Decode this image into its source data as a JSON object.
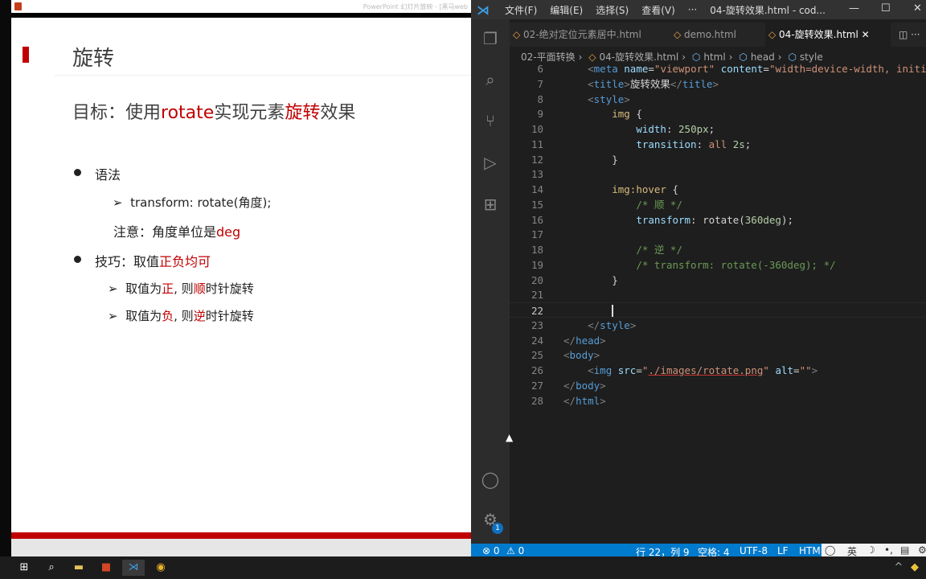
{
  "ppt": {
    "window_title": "PowerPoint 幻灯片放映 - [黑马web",
    "slide": {
      "title": "旋转",
      "goal": {
        "prefix": "目标：使用",
        "rotate": "rotate",
        "mid": "实现元素",
        "em": "旋转",
        "suffix": "效果"
      },
      "syntax_label": "语法",
      "syntax_item": "transform: rotate(角度);",
      "note": {
        "prefix": "注意：角度单位是",
        "em": "deg"
      },
      "tip": {
        "prefix": "技巧：取值",
        "em": "正负均可"
      },
      "tip_items": [
        {
          "a": "取值为",
          "b": "正",
          "c": ", 则",
          "d": "顺",
          "e": "时针旋转"
        },
        {
          "a": "取值为",
          "b": "负",
          "c": ", 则",
          "d": "逆",
          "e": "时针旋转"
        }
      ]
    }
  },
  "vscode": {
    "menu": [
      "文件(F)",
      "编辑(E)",
      "选择(S)",
      "查看(V)",
      "···"
    ],
    "window_title": "04-旋转效果.html - cod...",
    "tabs": [
      {
        "label": "02-绝对定位元素居中.html",
        "active": false
      },
      {
        "label": "demo.html",
        "active": false
      },
      {
        "label": "04-旋转效果.html",
        "active": true
      }
    ],
    "breadcrumb": [
      "02-平面转换",
      "04-旋转效果.html",
      "html",
      "head",
      "style"
    ],
    "current_line": 22,
    "lines": [
      {
        "n": 6,
        "t": [
          [
            "    ",
            "tx"
          ],
          [
            "<",
            "p"
          ],
          [
            "meta",
            "tg"
          ],
          [
            " name",
            "at"
          ],
          [
            "=",
            "tx"
          ],
          [
            "\"viewport\"",
            "st"
          ],
          [
            " content",
            "at"
          ],
          [
            "=",
            "tx"
          ],
          [
            "\"width=device-width, initi",
            "st"
          ]
        ]
      },
      {
        "n": 7,
        "t": [
          [
            "    ",
            "tx"
          ],
          [
            "<",
            "p"
          ],
          [
            "title",
            "tg"
          ],
          [
            ">",
            "p"
          ],
          [
            "旋转效果",
            "tx"
          ],
          [
            "</",
            "p"
          ],
          [
            "title",
            "tg"
          ],
          [
            ">",
            "p"
          ]
        ]
      },
      {
        "n": 8,
        "t": [
          [
            "    ",
            "tx"
          ],
          [
            "<",
            "p"
          ],
          [
            "style",
            "tg"
          ],
          [
            ">",
            "p"
          ]
        ]
      },
      {
        "n": 9,
        "t": [
          [
            "        ",
            "tx"
          ],
          [
            "img",
            "sel"
          ],
          [
            " {",
            "tx"
          ]
        ]
      },
      {
        "n": 10,
        "t": [
          [
            "            ",
            "tx"
          ],
          [
            "width",
            "pr"
          ],
          [
            ": ",
            "tx"
          ],
          [
            "250px",
            "n"
          ],
          [
            ";",
            "tx"
          ]
        ]
      },
      {
        "n": 11,
        "t": [
          [
            "            ",
            "tx"
          ],
          [
            "transition",
            "pr"
          ],
          [
            ": ",
            "tx"
          ],
          [
            "all",
            "v"
          ],
          [
            " 2s",
            "n"
          ],
          [
            ";",
            "tx"
          ]
        ]
      },
      {
        "n": 12,
        "t": [
          [
            "        ",
            "tx"
          ],
          [
            "}",
            "tx"
          ]
        ]
      },
      {
        "n": 13,
        "t": []
      },
      {
        "n": 14,
        "t": [
          [
            "        ",
            "tx"
          ],
          [
            "img:hover",
            "sel"
          ],
          [
            " {",
            "tx"
          ]
        ]
      },
      {
        "n": 15,
        "t": [
          [
            "            ",
            "tx"
          ],
          [
            "/* 顺 */",
            "cm"
          ]
        ]
      },
      {
        "n": 16,
        "t": [
          [
            "            ",
            "tx"
          ],
          [
            "transform",
            "pr"
          ],
          [
            ": rotate(",
            "tx"
          ],
          [
            "360deg",
            "n"
          ],
          [
            ");",
            "tx"
          ]
        ]
      },
      {
        "n": 17,
        "t": []
      },
      {
        "n": 18,
        "t": [
          [
            "            ",
            "tx"
          ],
          [
            "/* 逆 */",
            "cm"
          ]
        ]
      },
      {
        "n": 19,
        "t": [
          [
            "            ",
            "tx"
          ],
          [
            "/* transform: rotate(-360deg); */",
            "cm"
          ]
        ]
      },
      {
        "n": 20,
        "t": [
          [
            "        ",
            "tx"
          ],
          [
            "}",
            "tx"
          ]
        ]
      },
      {
        "n": 21,
        "t": []
      },
      {
        "n": 22,
        "t": []
      },
      {
        "n": 23,
        "t": [
          [
            "    ",
            "tx"
          ],
          [
            "</",
            "p"
          ],
          [
            "style",
            "tg"
          ],
          [
            ">",
            "p"
          ]
        ]
      },
      {
        "n": 24,
        "t": [
          [
            "</",
            "p"
          ],
          [
            "head",
            "tg"
          ],
          [
            ">",
            "p"
          ]
        ]
      },
      {
        "n": 25,
        "t": [
          [
            "<",
            "p"
          ],
          [
            "body",
            "tg"
          ],
          [
            ">",
            "p"
          ]
        ]
      },
      {
        "n": 26,
        "t": [
          [
            "    ",
            "tx"
          ],
          [
            "<",
            "p"
          ],
          [
            "img",
            "tg"
          ],
          [
            " src",
            "at"
          ],
          [
            "=",
            "tx"
          ],
          [
            "\"",
            "st"
          ],
          [
            "./images/rotate.png",
            "st u"
          ],
          [
            "\"",
            "st"
          ],
          [
            " alt",
            "at"
          ],
          [
            "=",
            "tx"
          ],
          [
            "\"\"",
            "st"
          ],
          [
            ">",
            "p"
          ]
        ]
      },
      {
        "n": 27,
        "t": [
          [
            "</",
            "p"
          ],
          [
            "body",
            "tg"
          ],
          [
            ">",
            "p"
          ]
        ]
      },
      {
        "n": 28,
        "t": [
          [
            "</",
            "p"
          ],
          [
            "html",
            "tg"
          ],
          [
            ">",
            "p"
          ]
        ]
      }
    ],
    "status": {
      "errors": "⊗ 0",
      "warnings": "⚠ 0",
      "position": "行 22，列 9",
      "spaces": "空格: 4",
      "encoding": "UTF-8",
      "eol": "LF",
      "language": "HTML",
      "ime": "英"
    },
    "settings_badge": "1",
    "colors": {
      "statusbar": "#007acc",
      "accent_red": "#c00000"
    }
  }
}
